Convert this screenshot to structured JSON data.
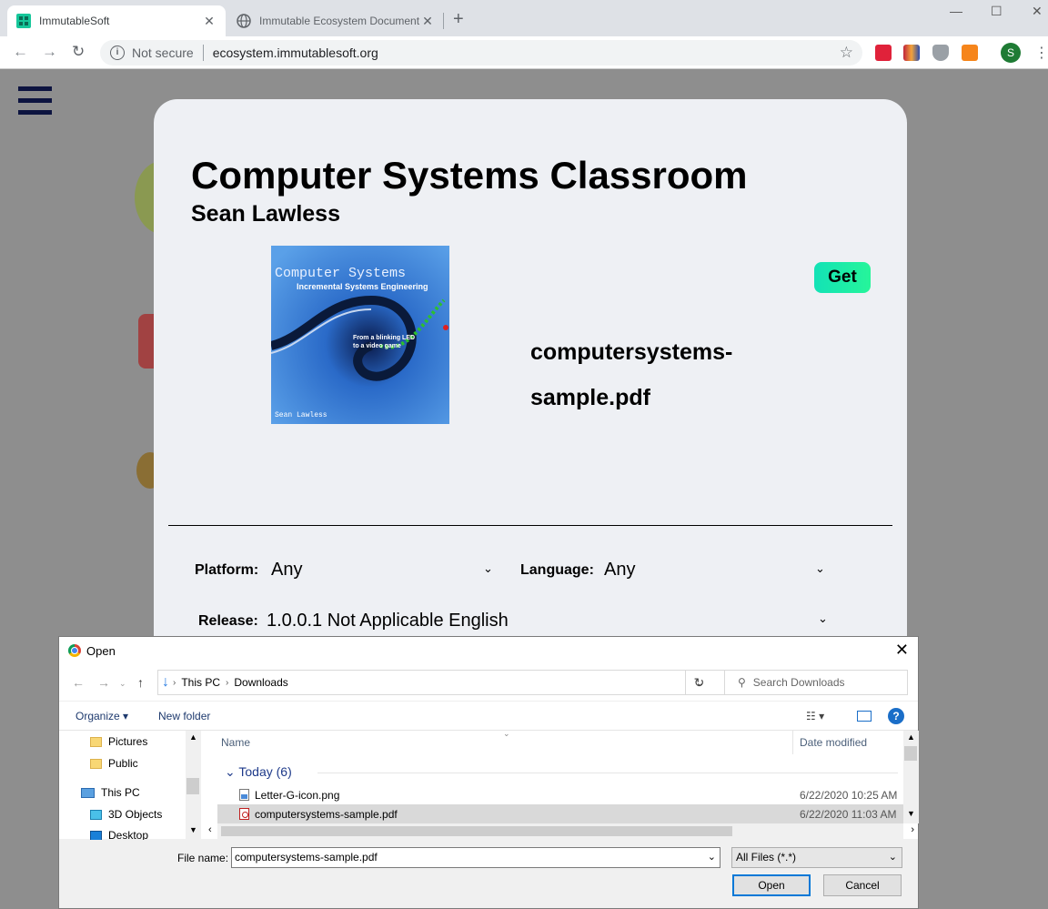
{
  "browser": {
    "tabs": [
      {
        "title": "ImmutableSoft"
      },
      {
        "title": "Immutable Ecosystem Document"
      }
    ],
    "new_tab_label": "+",
    "window_controls": {
      "minimize": "—",
      "maximize": "☐",
      "close": "✕"
    },
    "omnibox": {
      "security": "Not secure",
      "url": "ecosystem.immutablesoft.org"
    },
    "profile_initial": "S"
  },
  "page": {
    "title": "Computer Systems Classroom",
    "author": "Sean Lawless",
    "cover": {
      "title": "Computer Systems",
      "subtitle": "Incremental Systems Engineering",
      "tagline_1": "From a blinking LED",
      "tagline_2": "to a video game",
      "author": "Sean Lawless"
    },
    "get_label": "Get",
    "file_name": "computersystems-sample.pdf",
    "filters": {
      "platform_label": "Platform:",
      "platform_value": "Any",
      "language_label": "Language:",
      "language_value": "Any",
      "release_label": "Release:",
      "release_value": "1.0.0.1 Not Applicable English"
    }
  },
  "dialog": {
    "title": "Open",
    "breadcrumb": [
      "This PC",
      "Downloads"
    ],
    "search_placeholder": "Search Downloads",
    "organize_label": "Organize ▾",
    "new_folder_label": "New folder",
    "help_label": "?",
    "tree": [
      "Pictures",
      "Public",
      "This PC",
      "3D Objects",
      "Desktop"
    ],
    "columns": {
      "name": "Name",
      "date_modified": "Date modified"
    },
    "group_label": "Today (6)",
    "files": [
      {
        "name": "Letter-G-icon.png",
        "date": "6/22/2020 10:25 AM"
      },
      {
        "name": "computersystems-sample.pdf",
        "date": "6/22/2020 11:03 AM"
      }
    ],
    "file_name_label": "File name:",
    "file_name_value": "computersystems-sample.pdf",
    "file_type_value": "All Files (*.*)",
    "open_label": "Open",
    "cancel_label": "Cancel"
  }
}
